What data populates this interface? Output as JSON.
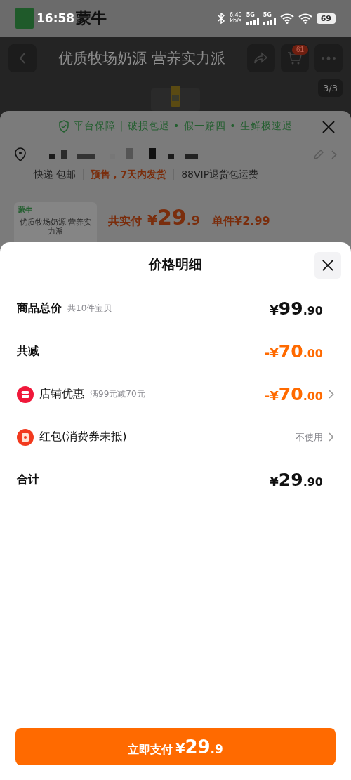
{
  "status_bar": {
    "time": "16:58",
    "brand": "蒙牛",
    "speed": "6.40",
    "speed_unit": "kb/s",
    "networks": [
      "5G",
      "5G"
    ],
    "battery": "69"
  },
  "product_header": {
    "title": "优质牧场奶源 营养实力派",
    "cart_badge": "61",
    "image_counter": "3/3"
  },
  "order_sheet": {
    "guarantee": "平台保障 | 破损包退 • 假一赔四 • 生鲜极速退",
    "delivery": [
      {
        "text": "快递 包邮",
        "kind": "plain"
      },
      {
        "text": "预售，7天内发货",
        "kind": "highlight"
      },
      {
        "text": "88VIP退货包运费",
        "kind": "plain"
      }
    ],
    "thumbnail": {
      "brand": "蒙牛",
      "caption": "优质牧场奶源 营养实力派"
    },
    "total_label": "共实付",
    "total": {
      "sign": "¥",
      "integer": "29",
      "decimal": ".9"
    },
    "unit_price": "单件¥2.99"
  },
  "price_detail": {
    "title": "价格明细",
    "rows": [
      {
        "kind": "plain",
        "label": "商品总价",
        "note": "共10件宝贝",
        "price": {
          "sign": "¥",
          "integer": "99",
          "decimal": ".90"
        },
        "discount": false,
        "chevron": false
      },
      {
        "kind": "plain",
        "label": "共减",
        "price": {
          "sign": "-¥",
          "integer": "70",
          "decimal": ".00"
        },
        "discount": true,
        "chevron": false
      },
      {
        "kind": "store",
        "label": "店铺优惠",
        "note": "满99元减70元",
        "price": {
          "sign": "-¥",
          "integer": "70",
          "decimal": ".00"
        },
        "discount": true,
        "chevron": true
      },
      {
        "kind": "redpacket",
        "label": "红包(消费券未抵)",
        "value": "不使用",
        "chevron": true
      },
      {
        "kind": "plain",
        "label": "合计",
        "price": {
          "sign": "¥",
          "integer": "29",
          "decimal": ".90"
        },
        "discount": false,
        "chevron": false
      }
    ],
    "pay_button": {
      "label": "立即支付",
      "price": {
        "sign": "¥",
        "integer": "29",
        "decimal": ".9"
      }
    }
  }
}
